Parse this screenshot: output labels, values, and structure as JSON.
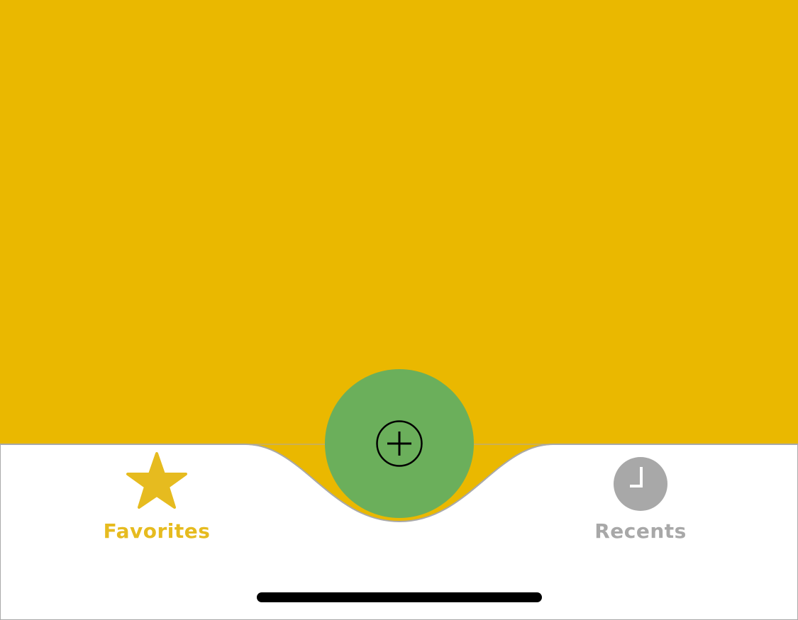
{
  "colors": {
    "content_background": "#EAB800",
    "tabbar_background": "#FFFFFF",
    "tabbar_border": "#A9A9A9",
    "fab_background": "#6BAF5B",
    "fab_icon": "#000000",
    "tab_active": "#E6BB1F",
    "tab_inactive": "#A8A8A8",
    "home_indicator": "#000000"
  },
  "fab": {
    "icon": "plus-circle-icon"
  },
  "tabs": [
    {
      "label": "Favorites",
      "icon": "star-icon",
      "active": true
    },
    {
      "label": "Recents",
      "icon": "clock-icon",
      "active": false
    }
  ]
}
